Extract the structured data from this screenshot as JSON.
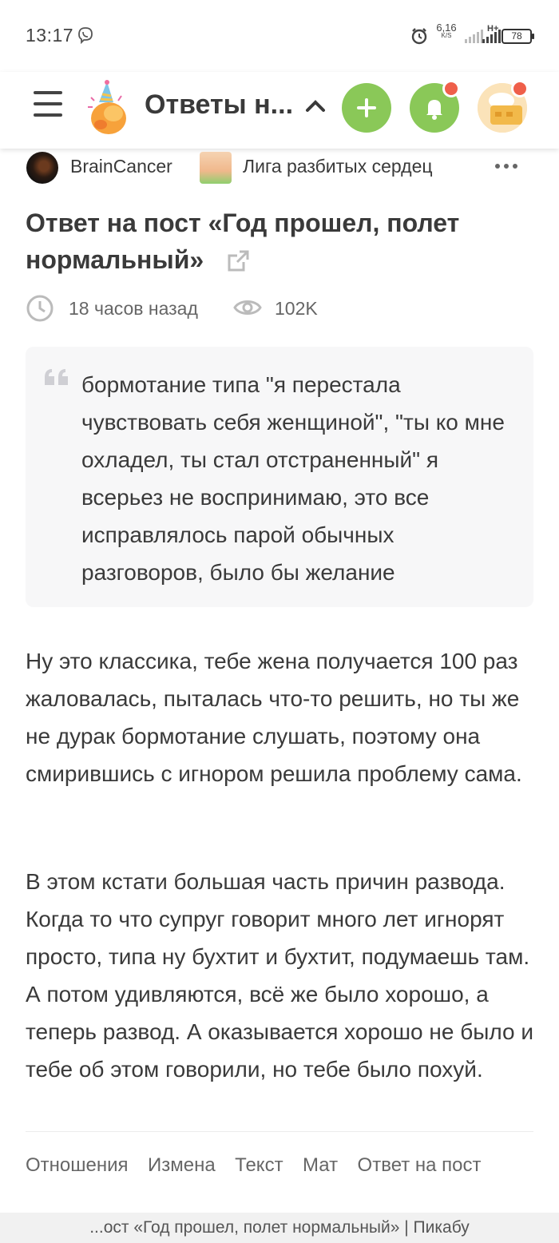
{
  "status_bar": {
    "time": "13:17",
    "net_speed_value": "6,16",
    "net_speed_unit": "K/S",
    "network_type": "H+",
    "battery": "78"
  },
  "header": {
    "title": "Ответы н...",
    "accent_color": "#8ac858",
    "badge_color": "#ef5f4a"
  },
  "post": {
    "author": "BrainCancer",
    "community": "Лига разбитых сердец",
    "title": "Ответ на пост «Год прошел, полет нормальный»",
    "time_ago": "18 часов назад",
    "views": "102K",
    "quote": "бормотание типа \"я перестала чувствовать себя женщиной\", \"ты ко мне охладел, ты стал отстраненный\" я всерьез не воспринимаю, это все исправлялось парой обычных разговоров, было бы желание",
    "paragraphs": [
      "Ну это классика, тебе жена получается 100 раз жаловалась, пыталась что-то решить, но ты же не дурак бормотание слушать, поэтому она смирившись с игнором решила проблему сама.",
      "В этом кстати большая часть причин развода. Когда то что супруг говорит много лет игнорят просто, типа ну бухтит и бухтит, подумаешь там. А потом удивляются, всё же было хорошо, а теперь развод. А оказывается хорошо не было и тебе об этом говорили, но тебе было похуй."
    ],
    "tags": [
      "Отношения",
      "Измена",
      "Текст",
      "Мат",
      "Ответ на пост"
    ]
  },
  "bottom_bar": {
    "page_title": "...ост «Год прошел, полет нормальный» | Пикабу"
  }
}
